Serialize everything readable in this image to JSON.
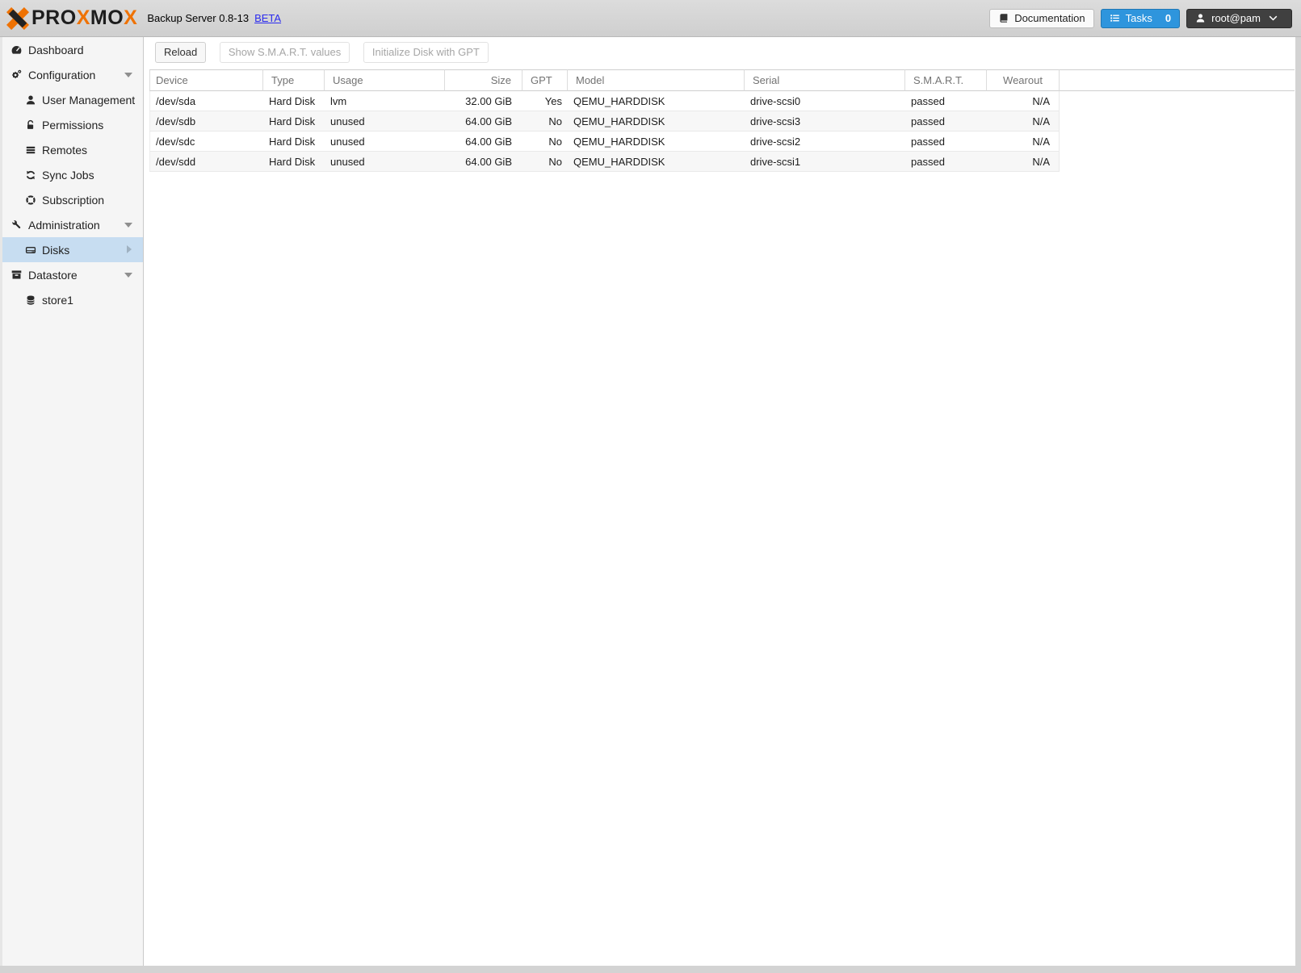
{
  "app": {
    "brand": {
      "logo": "proxmox-x-logo",
      "wordmark": [
        {
          "text": "PRO",
          "accent": false
        },
        {
          "text": "X",
          "accent": true
        },
        {
          "text": "MO",
          "accent": false
        },
        {
          "text": "X",
          "accent": true
        }
      ],
      "title": "Backup Server 0.8-13",
      "beta_label": "BETA"
    },
    "header_buttons": {
      "documentation": "Documentation",
      "tasks": "Tasks",
      "tasks_count": "0",
      "user": "root@pam"
    }
  },
  "sidebar": {
    "items": [
      {
        "label": "Dashboard"
      },
      {
        "label": "Configuration"
      },
      {
        "label": "User Management"
      },
      {
        "label": "Permissions"
      },
      {
        "label": "Remotes"
      },
      {
        "label": "Sync Jobs"
      },
      {
        "label": "Subscription"
      },
      {
        "label": "Administration"
      },
      {
        "label": "Disks"
      },
      {
        "label": "Datastore"
      },
      {
        "label": "store1"
      }
    ],
    "selected": "Disks"
  },
  "toolbar": {
    "reload_label": "Reload",
    "smart_label": "Show S.M.A.R.T. values",
    "init_gpt_label": "Initialize Disk with GPT"
  },
  "table": {
    "columns": [
      {
        "label": "Device"
      },
      {
        "label": "Type"
      },
      {
        "label": "Usage"
      },
      {
        "label": "Size"
      },
      {
        "label": "GPT"
      },
      {
        "label": "Model"
      },
      {
        "label": "Serial"
      },
      {
        "label": "S.M.A.R.T."
      },
      {
        "label": "Wearout"
      }
    ],
    "rows": [
      {
        "device": "/dev/sda",
        "type": "Hard Disk",
        "usage": "lvm",
        "size": "32.00 GiB",
        "gpt": "Yes",
        "model": "QEMU_HARDDISK",
        "serial": "drive-scsi0",
        "smart": "passed",
        "wearout": "N/A"
      },
      {
        "device": "/dev/sdb",
        "type": "Hard Disk",
        "usage": "unused",
        "size": "64.00 GiB",
        "gpt": "No",
        "model": "QEMU_HARDDISK",
        "serial": "drive-scsi3",
        "smart": "passed",
        "wearout": "N/A"
      },
      {
        "device": "/dev/sdc",
        "type": "Hard Disk",
        "usage": "unused",
        "size": "64.00 GiB",
        "gpt": "No",
        "model": "QEMU_HARDDISK",
        "serial": "drive-scsi2",
        "smart": "passed",
        "wearout": "N/A"
      },
      {
        "device": "/dev/sdd",
        "type": "Hard Disk",
        "usage": "unused",
        "size": "64.00 GiB",
        "gpt": "No",
        "model": "QEMU_HARDDISK",
        "serial": "drive-scsi1",
        "smart": "passed",
        "wearout": "N/A"
      }
    ]
  },
  "colors": {
    "accent_orange": "#ef7203",
    "tasks_button_blue": "#2e95dd",
    "selected_nav_blue": "#c7ddf1",
    "beta_link_blue": "#2b2bee",
    "smart_passed_text": "#1c1c1c"
  }
}
